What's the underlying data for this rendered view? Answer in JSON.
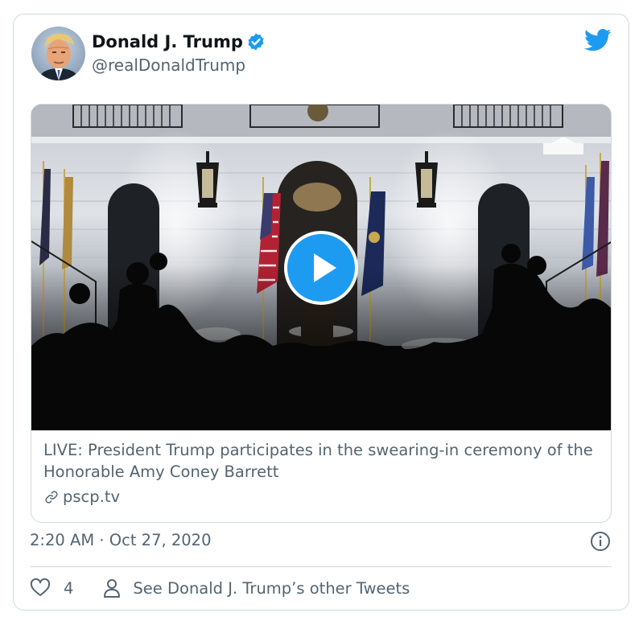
{
  "author": {
    "name": "Donald J. Trump",
    "handle": "@realDonaldTrump",
    "verified": true,
    "avatar_icon": "avatar-portrait"
  },
  "brand_icon": "twitter-bird-icon",
  "colors": {
    "twitter_blue": "#1d9bf0",
    "text_primary": "#0f1419",
    "text_secondary": "#536471",
    "border": "#cfd9de"
  },
  "card": {
    "title": "LIVE: President Trump participates in the swearing-in ceremony of the Honorable Amy Coney Barrett",
    "domain": "pscp.tv",
    "media_type": "video",
    "play_icon": "play-icon"
  },
  "timestamp": "2:20 AM · Oct 27, 2020",
  "actions": {
    "like_count": "4",
    "profile_link": "See Donald J. Trump’s other Tweets"
  }
}
